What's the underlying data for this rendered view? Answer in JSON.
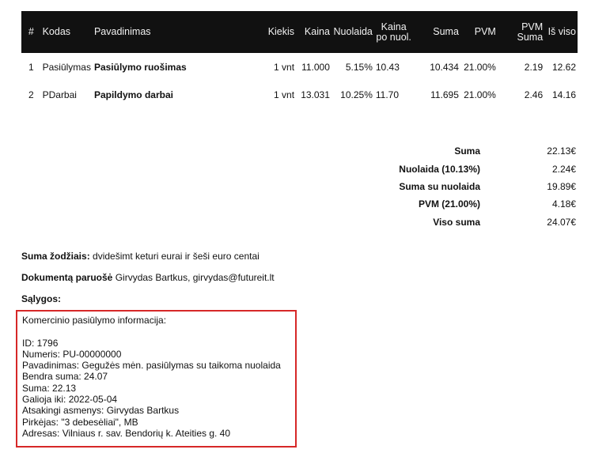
{
  "table": {
    "headers": [
      "#",
      "Kodas",
      "Pavadinimas",
      "Kiekis",
      "Kaina",
      "Nuolaida",
      "Kaina po nuol.",
      "Suma",
      "PVM",
      "PVM Suma",
      "Iš viso"
    ],
    "rows": [
      [
        "1",
        "Pasiūlymas",
        "Pasiūlymo ruošimas",
        "1 vnt",
        "11.000",
        "5.15%",
        "10.43",
        "10.434",
        "21.00%",
        "2.19",
        "12.62"
      ],
      [
        "2",
        "PDarbai",
        "Papildymo darbai",
        "1 vnt",
        "13.031",
        "10.25%",
        "11.70",
        "11.695",
        "21.00%",
        "2.46",
        "14.16"
      ]
    ]
  },
  "totals": [
    {
      "label": "Suma",
      "value": "22.13€"
    },
    {
      "label": "Nuolaida (10.13%)",
      "value": "2.24€"
    },
    {
      "label": "Suma su nuolaida",
      "value": "19.89€"
    },
    {
      "label": "PVM (21.00%)",
      "value": "4.18€"
    },
    {
      "label": "Viso suma",
      "value": "24.07€"
    }
  ],
  "words": {
    "label": "Suma žodžiais:",
    "value": "dvidešimt keturi eurai ir šeši euro centai"
  },
  "prepared": {
    "label": "Dokumentą paruošė",
    "value": "Girvydas Bartkus, girvydas@futureit.lt"
  },
  "terms": {
    "label": "Sąlygos:"
  },
  "info": {
    "title": "Komercinio pasiūlymo informacija:",
    "lines": [
      "ID:  1796",
      "Numeris:  PU-00000000",
      "Pavadinimas:  Gegužės mėn. pasiūlymas su taikoma nuolaida",
      "Bendra suma:  24.07",
      "Suma:  22.13",
      "Galioja iki:  2022-05-04",
      "Atsakingi asmenys:  Girvydas Bartkus",
      "Pirkėjas:  \"3 debesėliai\", MB",
      "Adresas:  Vilniaus r. sav. Bendorių k. Ateities g. 40"
    ]
  },
  "colors": {
    "header_bg": "#111111",
    "highlight_border": "#d62828"
  }
}
